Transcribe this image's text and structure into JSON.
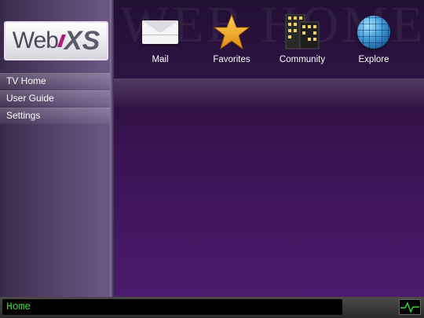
{
  "logo": {
    "text": "Web",
    "accent": "XS"
  },
  "watermark": "WEB HOME",
  "nav": {
    "items": [
      {
        "label": "TV Home"
      },
      {
        "label": "User Guide"
      },
      {
        "label": "Settings"
      }
    ]
  },
  "apps": [
    {
      "label": "Mail",
      "icon": "envelope-icon"
    },
    {
      "label": "Favorites",
      "icon": "star-icon"
    },
    {
      "label": "Community",
      "icon": "buildings-icon"
    },
    {
      "label": "Explore",
      "icon": "globe-icon"
    }
  ],
  "status": {
    "text": "Home"
  },
  "colors": {
    "accent": "#b01878",
    "status_text": "#33dd33"
  }
}
